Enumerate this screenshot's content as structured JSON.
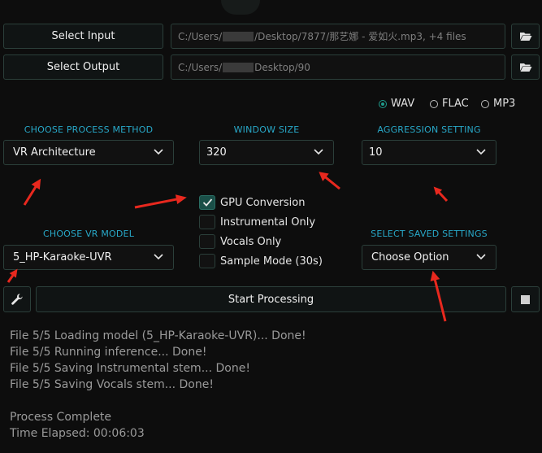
{
  "io": {
    "select_input_label": "Select Input",
    "input_path_prefix": "C:/Users/",
    "input_path_suffix": "/Desktop/7877/那艺娜 - 爱如火.mp3, +4 files",
    "select_output_label": "Select Output",
    "output_path_prefix": "C:/Users/",
    "output_path_suffix": "Desktop/90",
    "folder_icon": "folder-open-icon"
  },
  "format": {
    "options": [
      "WAV",
      "FLAC",
      "MP3"
    ],
    "selected": "WAV"
  },
  "process_method": {
    "label": "CHOOSE PROCESS METHOD",
    "value": "VR Architecture"
  },
  "window_size": {
    "label": "WINDOW SIZE",
    "value": "320"
  },
  "aggression": {
    "label": "AGGRESSION SETTING",
    "value": "10"
  },
  "options": {
    "gpu_conversion": {
      "label": "GPU Conversion",
      "checked": true
    },
    "instrumental_only": {
      "label": "Instrumental Only",
      "checked": false
    },
    "vocals_only": {
      "label": "Vocals Only",
      "checked": false
    },
    "sample_mode": {
      "label": "Sample Mode (30s)",
      "checked": false
    }
  },
  "vr_model": {
    "label": "CHOOSE VR MODEL",
    "value": "5_HP-Karaoke-UVR"
  },
  "saved_settings": {
    "label": "SELECT SAVED SETTINGS",
    "value": "Choose Option"
  },
  "actions": {
    "start_label": "Start Processing",
    "settings_icon": "wrench-icon",
    "stop_icon": "stop-icon"
  },
  "console": {
    "lines": [
      "File 5/5 Loading model (5_HP-Karaoke-UVR)... Done!",
      "File 5/5 Running inference... Done!",
      "File 5/5 Saving Instrumental stem... Done!",
      "File 5/5 Saving Vocals stem... Done!",
      "",
      "Process Complete",
      "Time Elapsed: 00:06:03"
    ]
  },
  "colors": {
    "accent": "#1f9c8c",
    "label": "#28a8c8",
    "annotation_arrow": "#e8281e"
  }
}
